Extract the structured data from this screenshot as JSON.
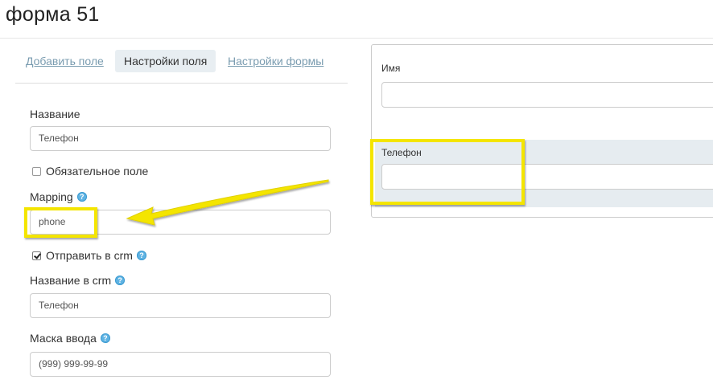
{
  "page": {
    "title": "форма 51"
  },
  "tabs": [
    {
      "label": "Добавить поле",
      "active": false
    },
    {
      "label": "Настройки поля",
      "active": true
    },
    {
      "label": "Настройки формы",
      "active": false
    }
  ],
  "field_settings": {
    "name_label": "Название",
    "name_value": "Телефон",
    "required_label": "Обязательное поле",
    "required_checked": false,
    "mapping_label": "Mapping",
    "mapping_value": "phone",
    "send_crm_label": "Отправить в crm",
    "send_crm_checked": true,
    "crm_name_label": "Название в crm",
    "crm_name_value": "Телефон",
    "mask_label": "Маска ввода",
    "mask_value": "(999) 999-99-99"
  },
  "preview": {
    "fields": [
      {
        "label": "Имя"
      },
      {
        "label": "Телефон",
        "selected": true
      }
    ]
  },
  "colors": {
    "highlight": "#f4e500",
    "help_icon": "#5fb3e3",
    "tab_link": "#7a9cb0",
    "tab_active_bg": "#e8eef2",
    "selected_row_bg": "#e6ecf0"
  },
  "icons": {
    "help": "question-circle-icon",
    "arrow": "annotation-arrow"
  }
}
